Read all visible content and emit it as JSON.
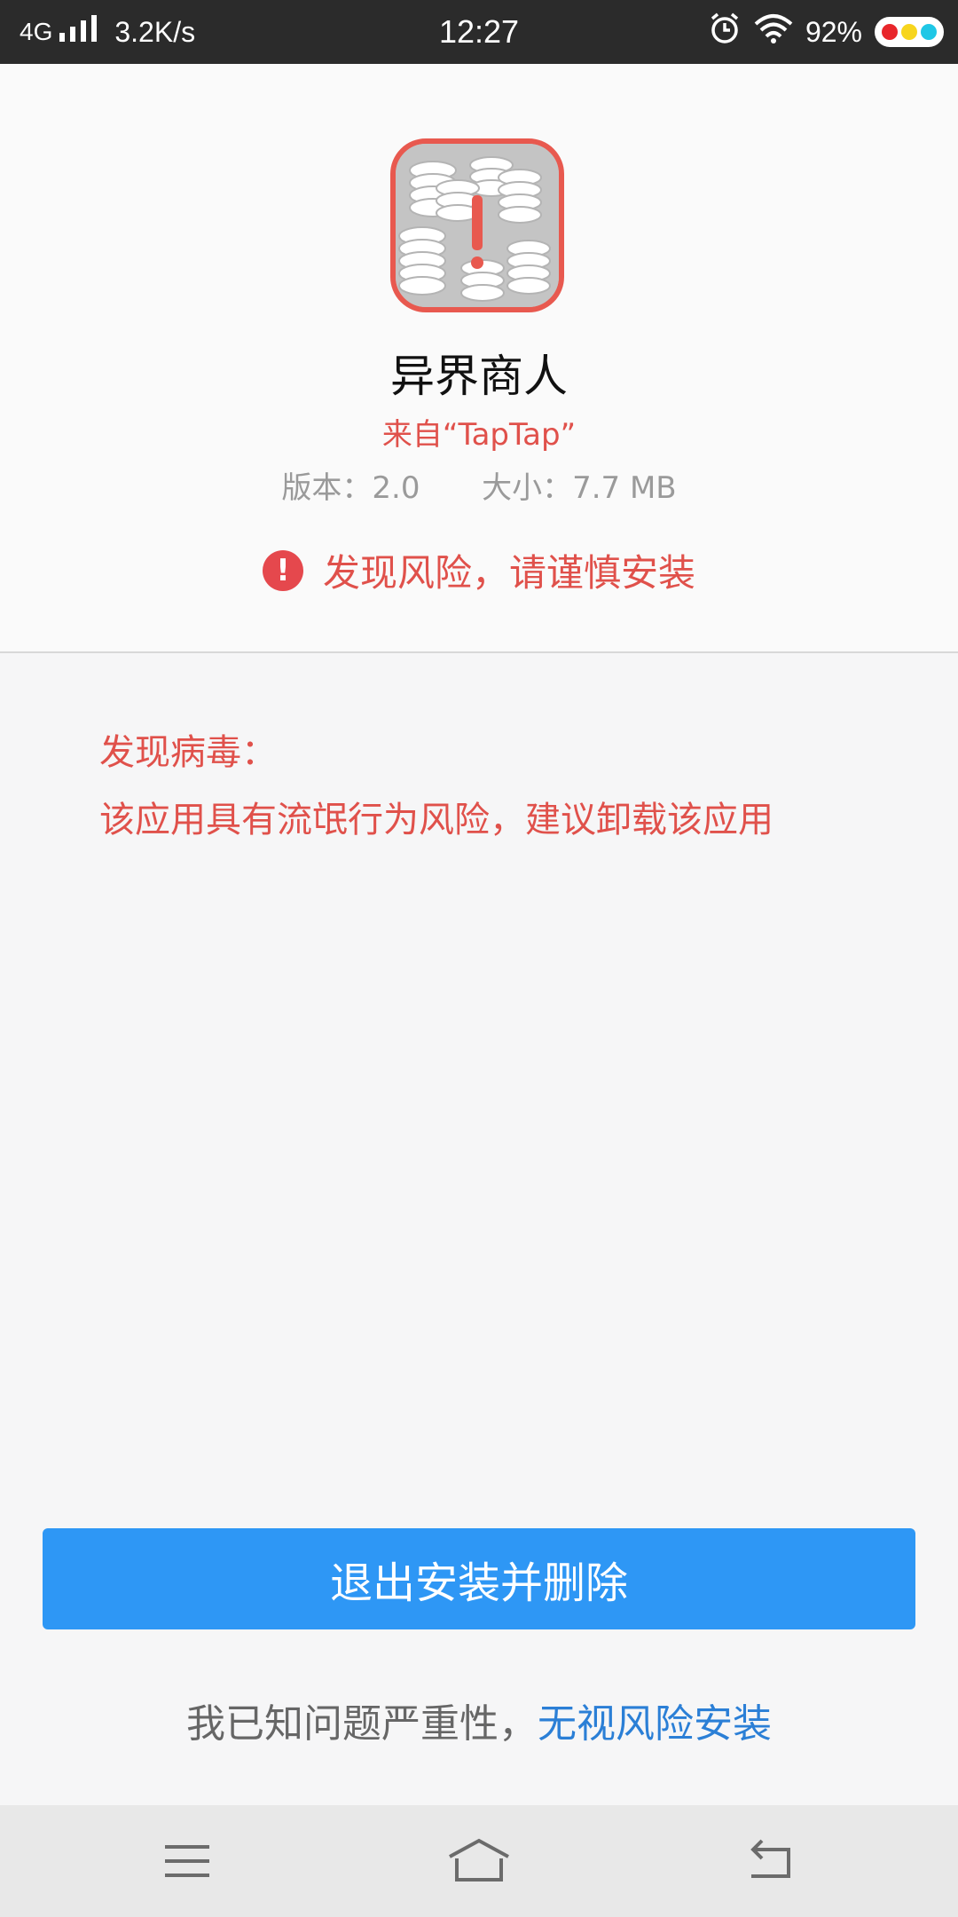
{
  "status_bar": {
    "network": "4G",
    "speed": "3.2K/s",
    "time": "12:27",
    "battery": "92%",
    "icons": [
      "signal-icon",
      "alarm-icon",
      "wifi-icon",
      "battery-icon"
    ]
  },
  "app": {
    "name": "异界商人",
    "source": "来自“TapTap”",
    "version": "版本：2.0",
    "size": "大小：7.7 MB",
    "risk_warning": "发现风险，请谨慎安装"
  },
  "virus": {
    "title": "发现病毒：",
    "description": "该应用具有流氓行为风险，建议卸载该应用"
  },
  "actions": {
    "exit_label": "退出安装并删除",
    "ignore_prefix": "我已知问题严重性，",
    "ignore_link": "无视风险安装"
  },
  "nav": {
    "icons": [
      "menu-icon",
      "home-icon",
      "back-icon"
    ]
  },
  "colors": {
    "accent": "#2e97f5",
    "danger": "#e0514b",
    "link": "#2b7fd6"
  }
}
